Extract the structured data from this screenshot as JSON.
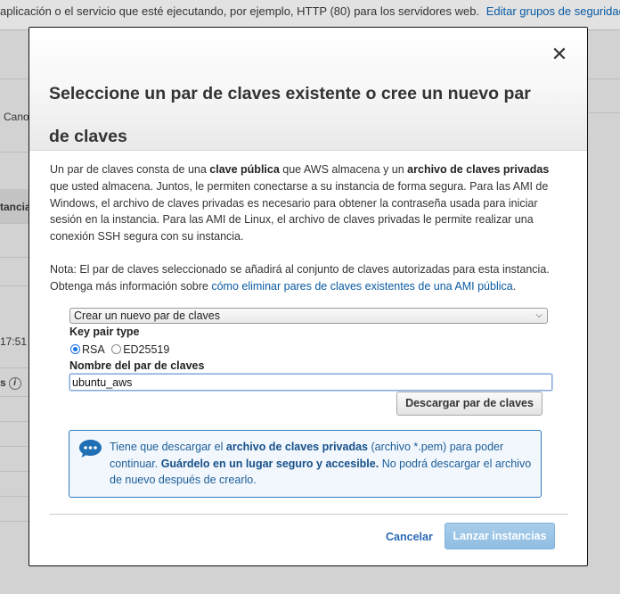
{
  "background": {
    "top_text": "aplicación o el servicio que esté ejecutando, por ejemplo, HTTP (80) para los servidores web.",
    "top_link": "Editar grupos de seguridad",
    "fragments": [
      "Cano",
      "tancia",
      "17:51",
      "s"
    ]
  },
  "modal": {
    "title": "Seleccione un par de claves existente o cree un nuevo par de claves",
    "close_icon": "close-icon",
    "body": {
      "p1_a": "Un par de claves consta de una ",
      "p1_b": "clave pública",
      "p1_c": " que AWS almacena y un ",
      "p1_d": "archivo de claves privadas",
      "p1_e": " que usted almacena. Juntos, le permiten conectarse a su instancia de forma segura. Para las AMI de Windows, el archivo de claves privadas es necesario para obtener la contraseña usada para iniciar sesión en la instancia. Para las AMI de Linux, el archivo de claves privadas le permite realizar una conexión SSH segura con su instancia.",
      "p2_a": "Nota: El par de claves seleccionado se añadirá al conjunto de claves autorizadas para esta instancia. Obtenga más información sobre ",
      "p2_link": "cómo eliminar pares de claves existentes de una AMI pública",
      "p2_end": "."
    },
    "select": {
      "value": "Crear un nuevo par de claves"
    },
    "key_pair_type": {
      "label": "Key pair type",
      "options": [
        "RSA",
        "ED25519"
      ],
      "selected": "RSA"
    },
    "name_field": {
      "label": "Nombre del par de claves",
      "value": "ubuntu_aws"
    },
    "download_button": "Descargar par de claves",
    "info": {
      "icon": "chat-bubble-icon",
      "a": "Tiene que descargar el ",
      "b": "archivo de claves privadas",
      "c": " (archivo *.pem) para poder continuar. ",
      "d": "Guárdelo en un lugar seguro y accesible.",
      "e": " No podrá descargar el archivo de nuevo después de crearlo."
    },
    "cancel": "Cancelar",
    "launch": "Lanzar instancias"
  },
  "colors": {
    "link": "#0a5aa1",
    "info_border": "#2e7bbf",
    "info_bg": "#f1f7fc",
    "launch_disabled": "#9cc5e6"
  }
}
